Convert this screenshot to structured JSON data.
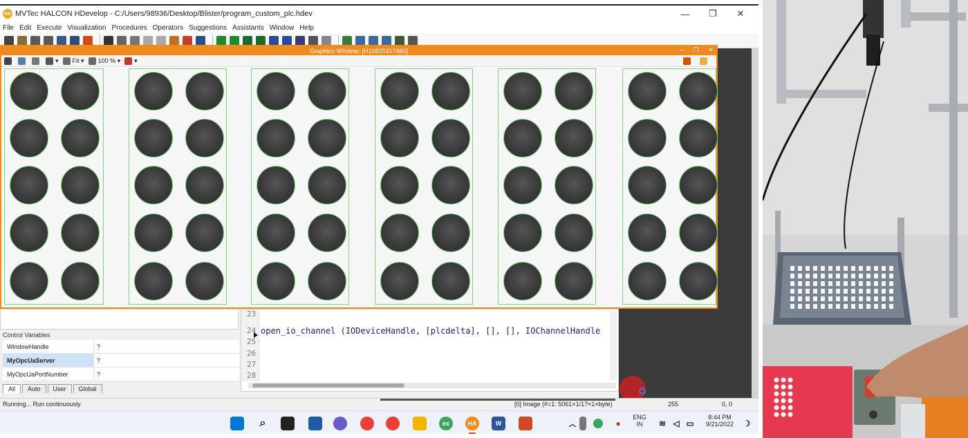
{
  "window": {
    "title": "MVTec HALCON HDevelop - C:/Users/98936/Desktop/Blister/program_custom_plc.hdev",
    "logo_text": "HA",
    "minimize": "—",
    "maximize": "❐",
    "close": "✕"
  },
  "menu": [
    "File",
    "Edit",
    "Execute",
    "Visualization",
    "Procedures",
    "Operators",
    "Suggestions",
    "Assistants",
    "Window",
    "Help"
  ],
  "graphics_window": {
    "title": "Graphics Window: [H16825417480]",
    "fit_label": "Fit",
    "zoom_label": "100 %",
    "controls": [
      "–",
      "❐",
      "✕"
    ]
  },
  "control_variables": {
    "header": "Control Variables",
    "rows": [
      {
        "name": "WindowHandle",
        "value": "?"
      },
      {
        "name": "MyOpcUaServer",
        "value": "?"
      },
      {
        "name": "MyOpcUaPortNumber",
        "value": "?"
      }
    ],
    "tabs": [
      "All",
      "Auto",
      "User",
      "Global"
    ],
    "active_tab": "All"
  },
  "editor": {
    "line_numbers": [
      "23",
      "24",
      "25",
      "26",
      "27",
      "28"
    ],
    "code_line": "open_io_channel (IODeviceHandle, [plcdelta], [], [], IOChannelHandle"
  },
  "status": {
    "left": "Running... Run continuously",
    "image": "[0] Image (#=1: 5061×1/1?×1×byte)",
    "gray": "255",
    "coords": "0, 0"
  },
  "taskbar": {
    "lang_top": "ENG",
    "lang_bottom": "IN",
    "time": "8:44 PM",
    "date": "9/21/2022",
    "app_labels": {
      "excel": "ex",
      "halcon": "HA",
      "word": "W"
    }
  },
  "colors": {
    "orange": "#f08a1c",
    "ring_green": "#79d079",
    "code_blue": "#1a237e",
    "selection": "#cfe1f5"
  }
}
